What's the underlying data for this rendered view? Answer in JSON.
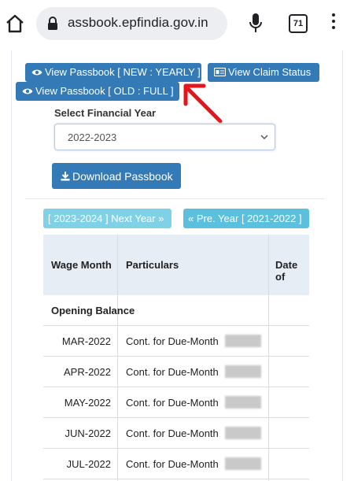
{
  "browser": {
    "url": "assbook.epfindia.gov.in",
    "tab_count": "71"
  },
  "buttons": {
    "view_passbook_yearly": "View Passbook [ NEW : YEARLY ]",
    "view_claim_status": "View Claim Status",
    "view_passbook_old": "View Passbook [ OLD : FULL ]",
    "download_passbook": "Download Passbook",
    "next_year": "[ 2023-2024 ] Next Year »",
    "prev_year": "« Pre. Year [ 2021-2022 ]"
  },
  "financial_year": {
    "label": "Select Financial Year",
    "selected": "2022-2023"
  },
  "table": {
    "columns": [
      "Wage Month",
      "Particulars",
      "Date of"
    ],
    "opening_label": "Opening Balance",
    "rows": [
      {
        "month": "MAR-2022",
        "particulars": "Cont. for Due-Month"
      },
      {
        "month": "APR-2022",
        "particulars": "Cont. for Due-Month"
      },
      {
        "month": "MAY-2022",
        "particulars": "Cont. for Due-Month"
      },
      {
        "month": "JUN-2022",
        "particulars": "Cont. for Due-Month"
      },
      {
        "month": "JUL-2022",
        "particulars": "Cont. for Due-Month"
      }
    ]
  },
  "colors": {
    "primary_button": "#337ab7",
    "info_button": "#5bc0de",
    "info_button_disabled": "#7fd1e8",
    "annotation_arrow": "#e8141b",
    "table_header_bg": "#e7edf5"
  }
}
